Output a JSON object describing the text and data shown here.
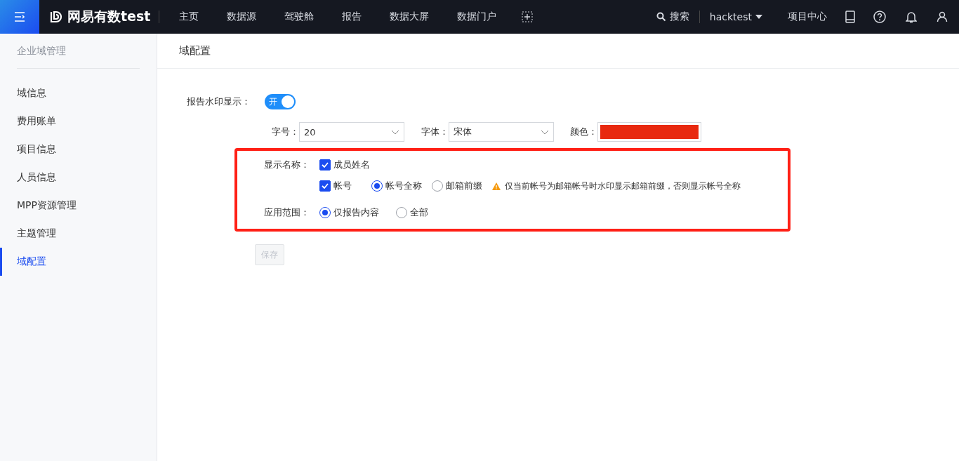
{
  "topbar": {
    "brand": "网易有数test",
    "nav": [
      {
        "label": "主页",
        "selected": false
      },
      {
        "label": "数据源",
        "selected": false
      },
      {
        "label": "驾驶舱",
        "selected": false
      },
      {
        "label": "报告",
        "selected": false
      },
      {
        "label": "数据大屏",
        "selected": false
      },
      {
        "label": "数据门户",
        "selected": false
      }
    ],
    "search": "搜索",
    "user": "hacktest",
    "project_center": "项目中心"
  },
  "sidebar": {
    "header": "企业域管理",
    "items": [
      {
        "label": "域信息",
        "selected": false
      },
      {
        "label": "费用账单",
        "selected": false
      },
      {
        "label": "项目信息",
        "selected": false
      },
      {
        "label": "人员信息",
        "selected": false
      },
      {
        "label": "MPP资源管理",
        "selected": false
      },
      {
        "label": "主题管理",
        "selected": false
      },
      {
        "label": "域配置",
        "selected": true
      }
    ]
  },
  "main": {
    "title": "域配置",
    "watermark": {
      "label": "报告水印显示：",
      "on": true,
      "switch_text": "开"
    },
    "font_size": {
      "label": "字号：",
      "value": "20"
    },
    "font": {
      "label": "字体：",
      "value": "宋体"
    },
    "color": {
      "label": "颜色：",
      "color": "#e8290f"
    },
    "display_name": {
      "label": "显示名称：",
      "options": [
        {
          "label": "成员姓名",
          "checked": true
        },
        {
          "label": "帐号",
          "checked": true
        }
      ]
    },
    "account_mode": [
      {
        "label": "帐号全称",
        "selected": true
      },
      {
        "label": "邮箱前缀",
        "selected": false
      }
    ],
    "hint": "仅当前帐号为邮箱帐号时水印显示邮箱前缀，否则显示帐号全称",
    "scope": {
      "label": "应用范围：",
      "options": [
        {
          "label": "仅报告内容",
          "selected": true
        },
        {
          "label": "全部",
          "selected": false
        }
      ]
    },
    "save": {
      "label": "保存",
      "disabled": true
    }
  }
}
